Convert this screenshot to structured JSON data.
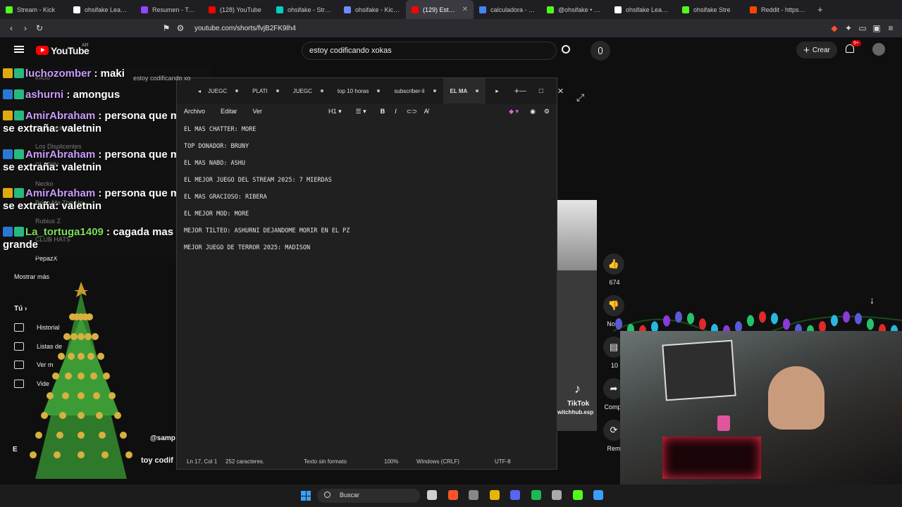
{
  "browser": {
    "tabs": [
      {
        "label": "Stream - Kick",
        "color": "#53fc18"
      },
      {
        "label": "ohsifake Leaderb",
        "color": "#ffffff"
      },
      {
        "label": "Resumen - Twitch",
        "color": "#9146ff"
      },
      {
        "label": "(128) YouTube",
        "color": "#ff0000"
      },
      {
        "label": "ohsifake - Stream",
        "color": "#00d1c1"
      },
      {
        "label": "ohsifake - Kick St",
        "color": "#6c8cff"
      },
      {
        "label": "(129) Estoy c",
        "color": "#ff0000",
        "active": true
      },
      {
        "label": "calculadora - Bus",
        "color": "#4285f4"
      },
      {
        "label": "@ohsifake • 2025",
        "color": "#53fc18"
      },
      {
        "label": "ohsifake Leaderb",
        "color": "#ffffff"
      },
      {
        "label": "ohsifake Stre",
        "color": "#53fc18"
      },
      {
        "label": "Reddit - https://p",
        "color": "#ff4500"
      }
    ],
    "new_tab": "+",
    "url": "youtube.com/shorts/fvjB2FK9lh4"
  },
  "youtube": {
    "logo_text": "YouTube",
    "country": "AR",
    "search_value": "estoy codificando xokas",
    "create_label": "Crear",
    "notif_count": "9+",
    "sidebar": {
      "items": [
        "Inicio",
        "Suscripciones",
        "Los Displicentes",
        "CLARIN",
        "Necko",
        "Bring Me The Ho...",
        "Rubius Z",
        "CLUB HATS",
        "PepazX",
        "Mostrar más"
      ],
      "you_label": "Tú",
      "you_items": [
        "Historial",
        "Listas de",
        "Ver m",
        "Vide"
      ],
      "extra": "E"
    },
    "short_actions": [
      {
        "icon": "like-icon",
        "label": "674"
      },
      {
        "icon": "dislike-icon",
        "label": "No m"
      },
      {
        "icon": "comment-icon",
        "label": "10"
      },
      {
        "icon": "share-icon",
        "label": "Compa"
      },
      {
        "icon": "remix-icon",
        "label": "Remi"
      }
    ],
    "video_caption": "estoy codificando xo",
    "tiktok_label": "TikTok",
    "tiktok_handle": "witchhub.esp",
    "channel_handle": "@samp",
    "channel_caption": "toy codif"
  },
  "chat": [
    {
      "user": "luchozomber",
      "msg": ": maki",
      "color": "#c99cff"
    },
    {
      "user": "ashurni",
      "msg": ": amongus",
      "color": "#c99cff"
    },
    {
      "user": "AmirAbraham",
      "msg": ": persona que mas se extraña: valetnin",
      "color": "#c99cff"
    },
    {
      "user": "AmirAbraham",
      "msg": ": persona que mas se extraña: valetnin",
      "color": "#c99cff"
    },
    {
      "user": "AmirAbraham",
      "msg": ": persona que mas se extraña: valetnin",
      "color": "#c99cff"
    },
    {
      "user": "La_tortuga1409",
      "msg": ": cagada mas grande",
      "color": "#7ddc5a"
    }
  ],
  "notepad": {
    "tabs": [
      "JUEGC",
      "PLATI",
      "JUEGC",
      "top 10 horas",
      "subscriber-li",
      "EL MA"
    ],
    "menu": [
      "Archivo",
      "Editar",
      "Ver"
    ],
    "heading": "H1",
    "lines": [
      "EL MAS CHATTER: MORE",
      "TOP DONADOR: BRUNY",
      "EL MAS NABO: ASHU",
      "EL MEJOR JUEGO DEL STREAM 2025: 7 MIERDAS",
      "EL MAS GRACIOSO: RIBERA",
      "EL MEJOR MOD: MORE",
      "MEJOR TILTEO: ASHURNI DEJANDOME MORIR EN EL PZ",
      "MEJOR JUEGO DE TERROR 2025: MADISON"
    ],
    "status": {
      "position": "Ln 17, Col 1",
      "chars": "252 caracteres.",
      "format": "Texto sin formato",
      "zoom": "100%",
      "eol": "Windows (CRLF)",
      "encoding": "UTF-8"
    }
  },
  "taskbar": {
    "search_placeholder": "Buscar"
  }
}
